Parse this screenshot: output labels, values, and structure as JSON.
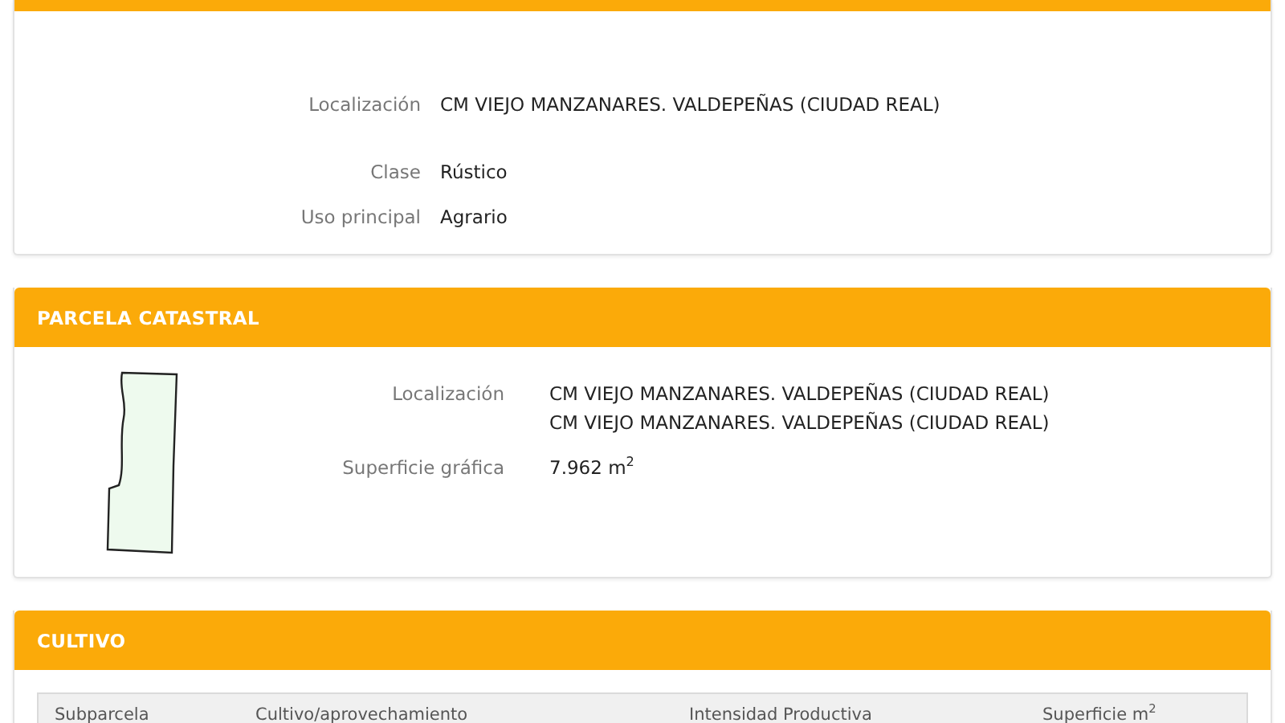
{
  "inmueble": {
    "fields": [
      {
        "label": "Localización",
        "values": [
          "CM VIEJO MANZANARES. VALDEPEÑAS (CIUDAD REAL)"
        ]
      },
      {
        "label": "Clase",
        "values": [
          "Rústico"
        ]
      },
      {
        "label": "Uso principal",
        "values": [
          "Agrario"
        ]
      }
    ]
  },
  "parcela": {
    "title": "PARCELA CATASTRAL",
    "fields": [
      {
        "label": "Localización",
        "values": [
          "CM VIEJO MANZANARES. VALDEPEÑAS (CIUDAD REAL)",
          "CM VIEJO MANZANARES. VALDEPEÑAS (CIUDAD REAL)"
        ]
      },
      {
        "label": "Superficie gráfica",
        "values": [
          "7.962 m$^{2}$"
        ]
      }
    ]
  },
  "cultivo": {
    "title": "CULTIVO",
    "table": {
      "columns": [
        "Subparcela",
        "Cultivo/aprovechamiento",
        "Intensidad Productiva",
        "Superficie m$^{2}$"
      ]
    }
  }
}
